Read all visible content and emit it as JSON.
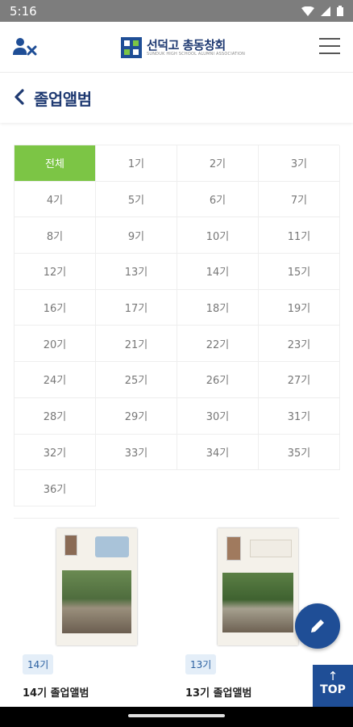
{
  "status": {
    "time": "5:16",
    "icons": [
      "wifi-icon",
      "signal-icon",
      "battery-icon"
    ]
  },
  "appbar": {
    "logo_text": "선덕고 총동창회",
    "logo_sub": "SUNDUK HIGH SCHOOL ALUMNI ASSOCIATION",
    "left_icon": "user-x-icon",
    "right_icon": "menu-icon"
  },
  "page": {
    "title": "졸업앨범"
  },
  "filters": {
    "active": "전체",
    "items": [
      "전체",
      "1기",
      "2기",
      "3기",
      "4기",
      "5기",
      "6기",
      "7기",
      "8기",
      "9기",
      "10기",
      "11기",
      "12기",
      "13기",
      "14기",
      "15기",
      "16기",
      "17기",
      "18기",
      "19기",
      "20기",
      "21기",
      "22기",
      "23기",
      "24기",
      "25기",
      "26기",
      "27기",
      "28기",
      "29기",
      "30기",
      "31기",
      "32기",
      "33기",
      "34기",
      "35기",
      "36기"
    ]
  },
  "albums": [
    {
      "tag": "14기",
      "title": "14기 졸업앨범"
    },
    {
      "tag": "13기",
      "title": "13기 졸업앨범"
    }
  ],
  "fab": {
    "icon": "pencil-icon"
  },
  "top_button": {
    "label": "TOP",
    "icon": "arrow-up-icon"
  },
  "colors": {
    "brand": "#1f4e96",
    "active": "#7cc545",
    "title": "#1f3a72"
  }
}
